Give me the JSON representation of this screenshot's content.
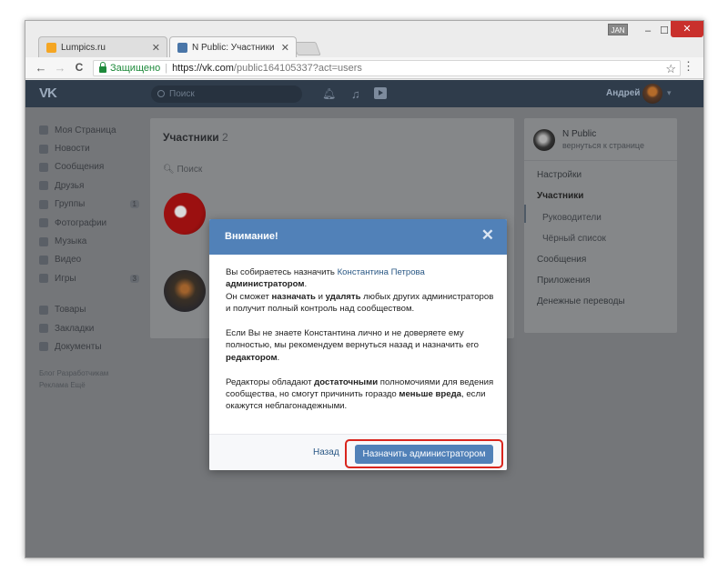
{
  "browser": {
    "tabs": [
      {
        "title": "Lumpics.ru",
        "favicon_color": "#f5a623",
        "active": false
      },
      {
        "title": "N Public: Участники",
        "favicon_color": "#4a76a8",
        "active": true
      }
    ],
    "keyboard_lang": "JAN",
    "window_controls": {
      "minimize": "–",
      "maximize": "☐",
      "close": "✕"
    },
    "nav": {
      "back": "←",
      "forward": "→",
      "reload": "C"
    },
    "address": {
      "secure_label": "Защищено",
      "separator": "|",
      "url_host": "https://vk.com",
      "url_path": "/public164105337?act=users"
    },
    "star_icon": "☆",
    "menu_icon": "⋮"
  },
  "vk": {
    "logo": "VK",
    "search_placeholder": "Поиск",
    "user_name": "Андрей",
    "menu": [
      {
        "label": "Моя Страница",
        "icon": "home-icon"
      },
      {
        "label": "Новости",
        "icon": "news-icon"
      },
      {
        "label": "Сообщения",
        "icon": "messages-icon"
      },
      {
        "label": "Друзья",
        "icon": "friends-icon"
      },
      {
        "label": "Группы",
        "icon": "groups-icon",
        "count": "1"
      },
      {
        "label": "Фотографии",
        "icon": "photos-icon"
      },
      {
        "label": "Музыка",
        "icon": "music-icon"
      },
      {
        "label": "Видео",
        "icon": "video-icon"
      },
      {
        "label": "Игры",
        "icon": "games-icon",
        "count": "3"
      }
    ],
    "menu2": [
      {
        "label": "Товары",
        "icon": "goods-icon"
      },
      {
        "label": "Закладки",
        "icon": "bookmarks-icon"
      },
      {
        "label": "Документы",
        "icon": "documents-icon"
      }
    ],
    "footer_line1": "Блог   Разработчикам",
    "footer_line2": "Реклама   Ещё",
    "members_title": "Участники",
    "members_count": "2",
    "members_search": "Поиск",
    "community": {
      "name": "N Public",
      "back": "вернуться к странице",
      "items": [
        {
          "label": "Настройки",
          "active": false,
          "sub": false
        },
        {
          "label": "Участники",
          "active": true,
          "sub": false
        },
        {
          "label": "Руководители",
          "active": false,
          "sub": true
        },
        {
          "label": "Чёрный список",
          "active": false,
          "sub": true
        },
        {
          "label": "Сообщения",
          "active": false,
          "sub": false
        },
        {
          "label": "Приложения",
          "active": false,
          "sub": false
        },
        {
          "label": "Денежные переводы",
          "active": false,
          "sub": false
        }
      ]
    }
  },
  "modal": {
    "title": "Внимание!",
    "close_icon": "✕",
    "p1_prefix": "Вы собираетесь назначить ",
    "p1_name": "Константина Петрова",
    "p1_role": "администратором",
    "p1_end": ".",
    "p2_a": "Он сможет ",
    "p2_b": "назначать",
    "p2_c": " и ",
    "p2_d": "удалять",
    "p2_e": " любых других администраторов и получит полный контроль над сообществом.",
    "p3_a": "Если Вы не знаете Константина лично и не доверяете ему полностью, мы рекомендуем вернуться назад и назначить его ",
    "p3_b": "редактором",
    "p3_c": ".",
    "p4_a": "Редакторы обладают ",
    "p4_b": "достаточными",
    "p4_c": " полномочиями для ведения сообщества, но смогут причинить гораздо ",
    "p4_d": "меньше вреда",
    "p4_e": ", если окажутся неблагонадежными.",
    "back_label": "Назад",
    "confirm_label": "Назначить администратором"
  }
}
